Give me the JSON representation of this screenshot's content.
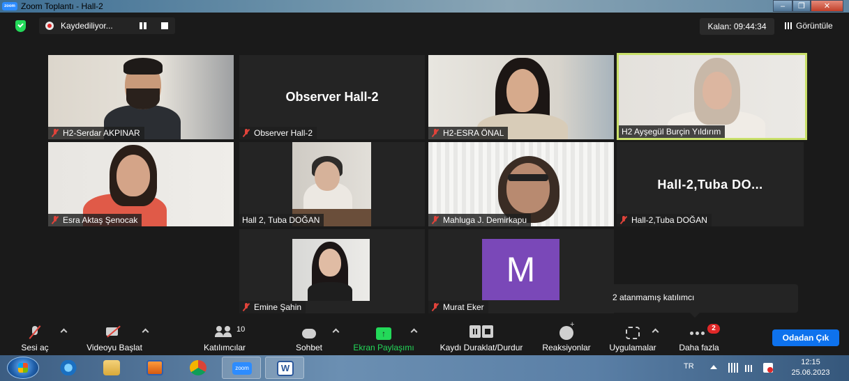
{
  "window": {
    "title": "Zoom Toplantı - Hall-2",
    "app_badge": "zoom",
    "controls": {
      "minimize": "–",
      "maximize": "❐",
      "close": "✕"
    }
  },
  "topbar": {
    "recording_text": "Kaydediliyor...",
    "timer": "Kalan: 09:44:34",
    "view_label": "Görüntüle"
  },
  "tiles": [
    {
      "name": "H2-Serdar AKPINAR",
      "muted": true,
      "video": true
    },
    {
      "name": "Observer Hall-2",
      "muted": true,
      "video": false,
      "label": "Observer Hall-2"
    },
    {
      "name": "H2-ESRA ÖNAL",
      "muted": true,
      "video": true
    },
    {
      "name": "H2 Ayşegül Burçin Yıldırım",
      "muted": false,
      "video": true,
      "active_speaker": true
    },
    {
      "name": "Esra Aktaş Şenocak",
      "muted": true,
      "video": true
    },
    {
      "name": "Hall 2, Tuba DOĞAN",
      "muted": false,
      "video": true
    },
    {
      "name": "Mahluga J. Demirkapu",
      "muted": true,
      "video": true
    },
    {
      "name": "Hall-2,Tuba DOĞAN",
      "muted": true,
      "video": false,
      "label": "Hall-2,Tuba  DO..."
    },
    {
      "name": "Emine Şahin",
      "muted": true,
      "video": true
    },
    {
      "name": "Murat Eker",
      "muted": true,
      "video": false,
      "avatar_letter": "M"
    }
  ],
  "popup": {
    "text": "2 atanmamış katılımcı"
  },
  "toolbar": {
    "mic_label": "Sesi aç",
    "video_label": "Videoyu Başlat",
    "participants_label": "Katılımcılar",
    "participants_count": "10",
    "chat_label": "Sohbet",
    "share_label": "Ekran Paylaşımı",
    "share_arrow": "↑",
    "record_label": "Kaydı Duraklat/Durdur",
    "reactions_label": "Reaksiyonlar",
    "apps_label": "Uygulamalar",
    "more_label": "Daha fazla",
    "more_badge": "2",
    "leave_label": "Odadan Çık"
  },
  "taskbar": {
    "apps": [
      "start",
      "internet-explorer",
      "file-explorer",
      "media-player",
      "chrome",
      "zoom",
      "word"
    ],
    "zoom_label": "zoom",
    "word_label": "W",
    "language": "TR",
    "time": "12:15",
    "date": "25.06.2023"
  },
  "colors": {
    "accent_green": "#23d959",
    "leave_blue": "#0e72ed",
    "active_outline": "#c9e06a",
    "avatar_purple": "#7a48b8",
    "muted_red": "#e0433a"
  }
}
